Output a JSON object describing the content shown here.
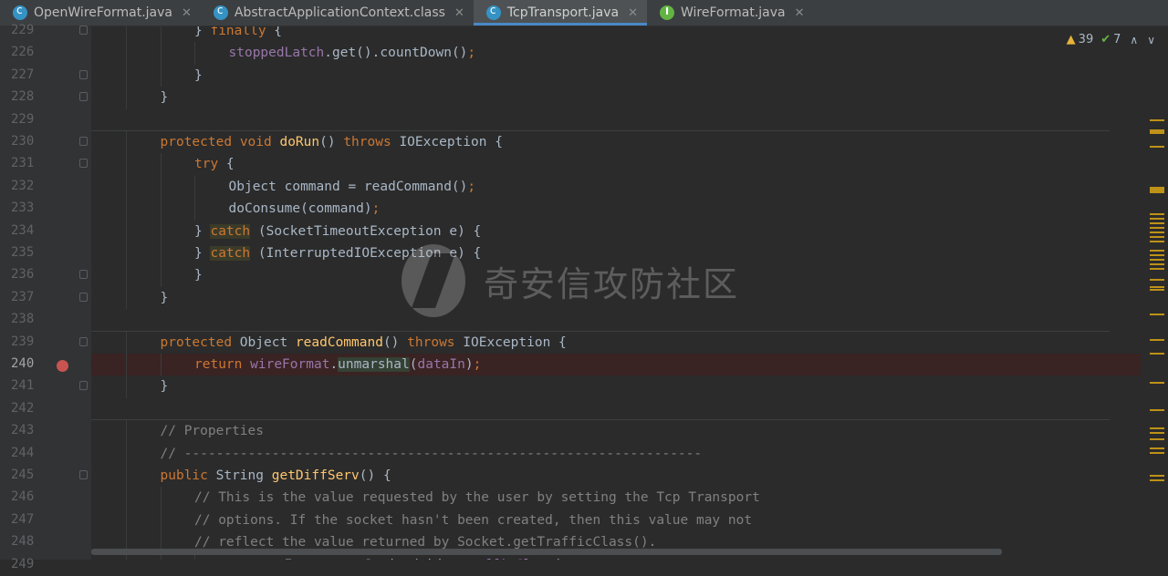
{
  "tabs": [
    {
      "label": "OpenWireFormat.java",
      "icon": "class-icon",
      "active": false
    },
    {
      "label": "AbstractApplicationContext.class",
      "icon": "class-icon",
      "active": false
    },
    {
      "label": "TcpTransport.java",
      "icon": "class-icon",
      "active": true
    },
    {
      "label": "WireFormat.java",
      "icon": "interface-icon",
      "active": false
    }
  ],
  "inspections": {
    "warnings": "39",
    "ok": "7"
  },
  "watermark": "奇安信攻防社区",
  "lines": [
    {
      "num": "229",
      "code": "} finally {"
    },
    {
      "num": "226",
      "code": "stoppedLatch.get().countDown();"
    },
    {
      "num": "227",
      "code": "}"
    },
    {
      "num": "228",
      "code": "}"
    },
    {
      "num": "229",
      "code": ""
    },
    {
      "num": "230",
      "code": "protected void doRun() throws IOException {"
    },
    {
      "num": "231",
      "code": "try {"
    },
    {
      "num": "232",
      "code": "Object command = readCommand();"
    },
    {
      "num": "233",
      "code": "doConsume(command);"
    },
    {
      "num": "234",
      "code": "} catch (SocketTimeoutException e) {"
    },
    {
      "num": "235",
      "code": "} catch (InterruptedIOException e) {"
    },
    {
      "num": "236",
      "code": "}"
    },
    {
      "num": "237",
      "code": "}"
    },
    {
      "num": "238",
      "code": ""
    },
    {
      "num": "239",
      "code": "protected Object readCommand() throws IOException {"
    },
    {
      "num": "240",
      "code": "return wireFormat.unmarshal(dataIn);"
    },
    {
      "num": "241",
      "code": "}"
    },
    {
      "num": "242",
      "code": ""
    },
    {
      "num": "243",
      "code": "// Properties"
    },
    {
      "num": "244",
      "code": "// -----------------------------------------------------------------"
    },
    {
      "num": "245",
      "code": "public String getDiffServ() {"
    },
    {
      "num": "246",
      "code": "// This is the value requested by the user by setting the Tcp Transport"
    },
    {
      "num": "247",
      "code": "// options. If the socket hasn't been created, then this value may not"
    },
    {
      "num": "248",
      "code": "// reflect the value returned by Socket.getTrafficClass()."
    },
    {
      "num": "249",
      "code": "return Integer.toString(this.trafficClass);"
    }
  ]
}
